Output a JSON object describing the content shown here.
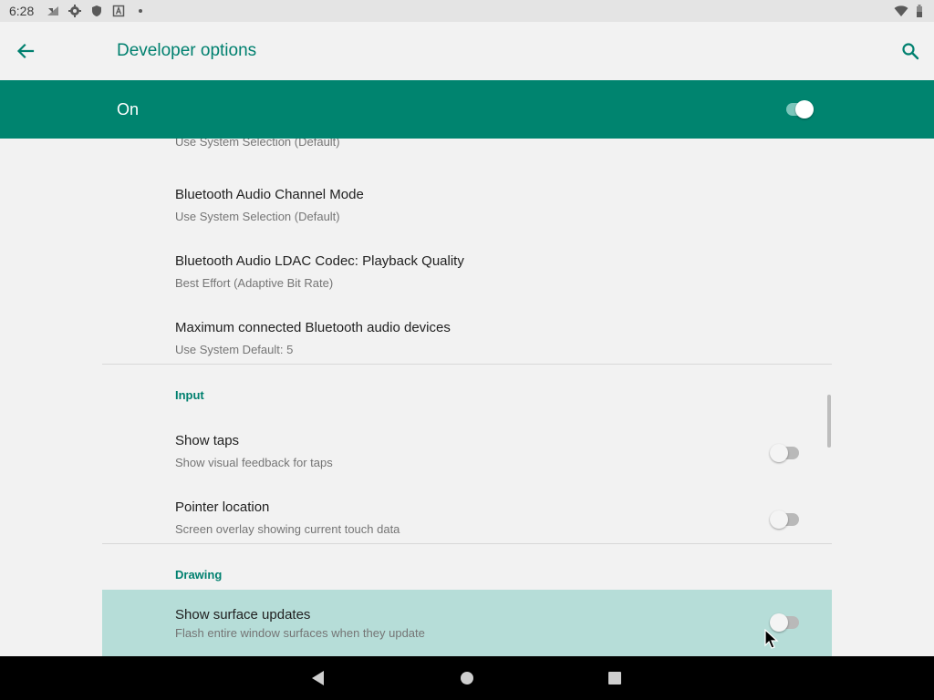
{
  "status_bar": {
    "time": "6:28",
    "icons": [
      "signal-icon",
      "gear-icon",
      "shield-icon",
      "a-box-icon",
      "dot-icon"
    ],
    "right_icons": [
      "wifi-icon",
      "battery-icon"
    ]
  },
  "toolbar": {
    "title": "Developer options",
    "back_icon": "arrow-back-icon",
    "search_icon": "search-icon"
  },
  "master": {
    "label": "On",
    "checked": true
  },
  "list": {
    "partial_summary": "Use System Selection (Default)",
    "items": [
      {
        "title": "Bluetooth Audio Channel Mode",
        "summary": "Use System Selection (Default)"
      },
      {
        "title": "Bluetooth Audio LDAC Codec: Playback Quality",
        "summary": "Best Effort (Adaptive Bit Rate)"
      },
      {
        "title": "Maximum connected Bluetooth audio devices",
        "summary": "Use System Default: 5"
      }
    ],
    "input_category": "Input",
    "input_items": [
      {
        "title": "Show taps",
        "summary": "Show visual feedback for taps",
        "checked": false
      },
      {
        "title": "Pointer location",
        "summary": "Screen overlay showing current touch data",
        "checked": false
      }
    ],
    "drawing_category": "Drawing",
    "drawing_items": [
      {
        "title": "Show surface updates",
        "summary": "Flash entire window surfaces when they update",
        "checked": false
      }
    ]
  },
  "colors": {
    "accent": "#00806f",
    "on_bar": "#00846f",
    "highlight": "#b6ddd8"
  },
  "nav_bar": {
    "back": "nav-back-icon",
    "home": "nav-home-icon",
    "recents": "nav-recents-icon"
  }
}
